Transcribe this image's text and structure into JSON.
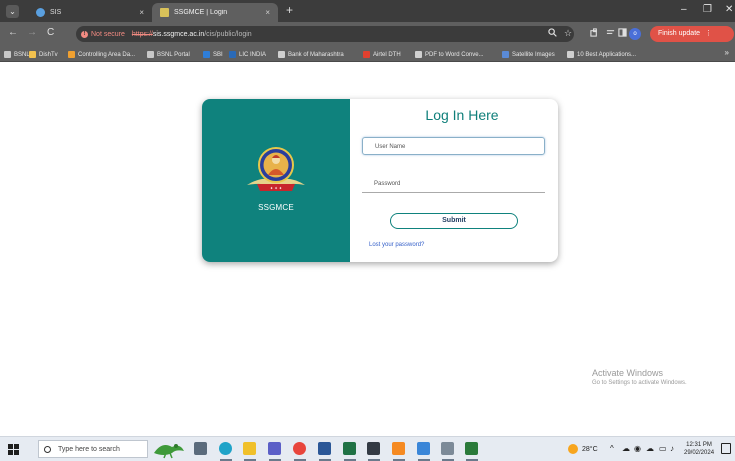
{
  "browser": {
    "tabs": [
      {
        "title": "SIS",
        "active": false
      },
      {
        "title": "SSGMCE | Login",
        "active": true
      }
    ],
    "tab_close": "×",
    "new_tab": "+",
    "window_controls": {
      "minimize": "–",
      "maximize": "❐",
      "close": "✕"
    },
    "nav": {
      "back": "←",
      "forward": "→",
      "reload": "C"
    },
    "address": {
      "security_label": "Not secure",
      "scheme": "https://",
      "host": "sis.ssgmce.ac.in",
      "path": "/cis/public/login"
    },
    "profile_initial": "o",
    "finish_update_label": "Finish update",
    "bookmarks": [
      {
        "label": "BSNL",
        "color": "#c8c8c8"
      },
      {
        "label": "DishTv",
        "color": "#f2c14e"
      },
      {
        "label": "Controlling Area Da...",
        "color": "#f0a030"
      },
      {
        "label": "BSNL Portal",
        "color": "#c8c8c8"
      },
      {
        "label": "SBI",
        "color": "#2f7ed8"
      },
      {
        "label": "LIC INDIA",
        "color": "#2a6ab8"
      },
      {
        "label": "Bank of Maharashtra",
        "color": "#d0d0d0"
      },
      {
        "label": "Airtel DTH",
        "color": "#e0402f"
      },
      {
        "label": "PDF to Word Conve...",
        "color": "#d0d0d0"
      },
      {
        "label": "Satellite Images",
        "color": "#5a8ad6"
      },
      {
        "label": "10 Best Applications...",
        "color": "#d0d0d0"
      }
    ],
    "bookmarks_more": "»"
  },
  "login": {
    "brand": "SSGMCE",
    "title": "Log In Here",
    "username_placeholder": "User Name",
    "password_placeholder": "Password",
    "submit_label": "Submit",
    "lost_password_label": "Lost your password?"
  },
  "watermark": {
    "line1": "Activate Windows",
    "line2": "Go to Settings to activate Windows."
  },
  "taskbar": {
    "search_placeholder": "Type here to search",
    "weather": "28°C",
    "time": "12:31 PM",
    "date": "29/02/2024",
    "apps": [
      {
        "name": "task-view-icon",
        "color": "#5b6b7c"
      },
      {
        "name": "edge-icon",
        "color": "#1fa3c8"
      },
      {
        "name": "file-explorer-icon",
        "color": "#f0c02a"
      },
      {
        "name": "teams-icon",
        "color": "#5b5fc7"
      },
      {
        "name": "chrome-icon",
        "color": "#e8453c"
      },
      {
        "name": "word-icon",
        "color": "#2b5797"
      },
      {
        "name": "excel-icon",
        "color": "#207245"
      },
      {
        "name": "mail-icon",
        "color": "#333a44"
      },
      {
        "name": "sublime-icon",
        "color": "#f58a22"
      },
      {
        "name": "photos-icon",
        "color": "#3a86d8"
      },
      {
        "name": "pen-icon",
        "color": "#7c8a98"
      },
      {
        "name": "app-icon",
        "color": "#2a7a3a"
      }
    ]
  },
  "colors": {
    "brand_teal": "#0f827d",
    "title_teal": "#0f7f7a",
    "link_blue": "#3560c9"
  }
}
